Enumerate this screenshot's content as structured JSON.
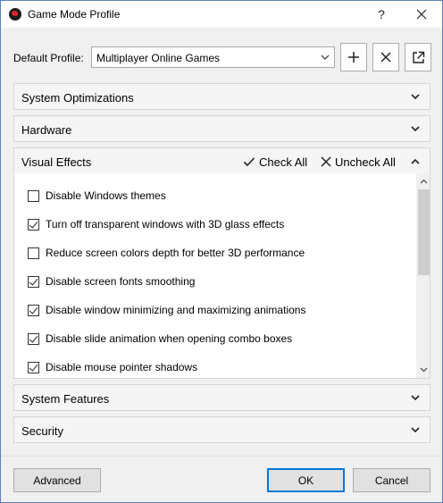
{
  "window": {
    "title": "Game Mode Profile",
    "help_label": "?",
    "close_label": "✕"
  },
  "profile": {
    "label": "Default Profile:",
    "selected": "Multiplayer Online Games",
    "icons": [
      "add-icon",
      "delete-icon",
      "export-icon"
    ]
  },
  "sections": {
    "system_optimizations": "System Optimizations",
    "hardware": "Hardware",
    "visual_effects": "Visual Effects",
    "system_features": "System Features",
    "security": "Security"
  },
  "visual_effects": {
    "check_all": "Check All",
    "uncheck_all": "Uncheck All",
    "items": [
      {
        "label": "Disable Windows themes",
        "checked": false
      },
      {
        "label": "Turn off transparent windows with 3D glass effects",
        "checked": true
      },
      {
        "label": "Reduce screen colors depth for better 3D performance",
        "checked": false
      },
      {
        "label": "Disable screen fonts smoothing",
        "checked": true
      },
      {
        "label": "Disable window minimizing and maximizing animations",
        "checked": true
      },
      {
        "label": "Disable slide animation when opening combo boxes",
        "checked": true
      },
      {
        "label": "Disable mouse pointer shadows",
        "checked": true
      }
    ]
  },
  "footer": {
    "advanced": "Advanced",
    "ok": "OK",
    "cancel": "Cancel"
  },
  "colors": {
    "accent": "#0078d7",
    "border": "#d5d5d5",
    "icon_red": "#d4242a"
  }
}
